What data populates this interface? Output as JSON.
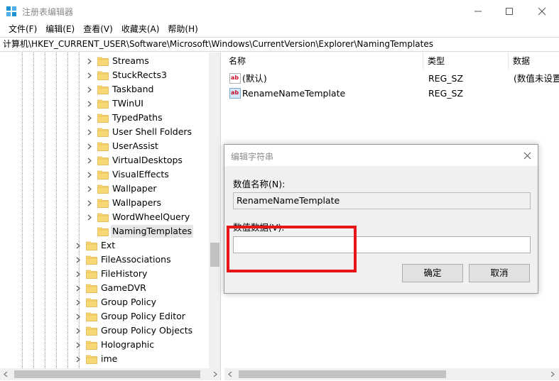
{
  "window": {
    "title": "注册表编辑器",
    "minimize_label": "minimize",
    "maximize_label": "maximize",
    "close_label": "close"
  },
  "menu": [
    {
      "label": "文件(F)"
    },
    {
      "label": "编辑(E)"
    },
    {
      "label": "查看(V)"
    },
    {
      "label": "收藏夹(A)"
    },
    {
      "label": "帮助(H)"
    }
  ],
  "address": "计算机\\HKEY_CURRENT_USER\\Software\\Microsoft\\Windows\\CurrentVersion\\Explorer\\NamingTemplates",
  "tree": {
    "items": [
      {
        "label": "Streams",
        "level": 1
      },
      {
        "label": "StuckRects3",
        "level": 1
      },
      {
        "label": "Taskband",
        "level": 1
      },
      {
        "label": "TWinUI",
        "level": 1
      },
      {
        "label": "TypedPaths",
        "level": 1
      },
      {
        "label": "User Shell Folders",
        "level": 1
      },
      {
        "label": "UserAssist",
        "level": 1
      },
      {
        "label": "VirtualDesktops",
        "level": 1
      },
      {
        "label": "VisualEffects",
        "level": 1
      },
      {
        "label": "Wallpaper",
        "level": 1
      },
      {
        "label": "Wallpapers",
        "level": 1
      },
      {
        "label": "WordWheelQuery",
        "level": 1
      },
      {
        "label": "NamingTemplates",
        "level": 1,
        "selected": true
      },
      {
        "label": "Ext",
        "level": 0
      },
      {
        "label": "FileAssociations",
        "level": 0
      },
      {
        "label": "FileHistory",
        "level": 0
      },
      {
        "label": "GameDVR",
        "level": 0
      },
      {
        "label": "Group Policy",
        "level": 0
      },
      {
        "label": "Group Policy Editor",
        "level": 0
      },
      {
        "label": "Group Policy Objects",
        "level": 0
      },
      {
        "label": "Holographic",
        "level": 0
      },
      {
        "label": "ime",
        "level": 0
      }
    ]
  },
  "list": {
    "columns": [
      "名称",
      "类型",
      "数据"
    ],
    "rows": [
      {
        "name": "(默认)",
        "type": "REG_SZ",
        "data": "(数值未设置)"
      },
      {
        "name": "RenameNameTemplate",
        "type": "REG_SZ",
        "data": ""
      }
    ]
  },
  "dialog": {
    "title": "编辑字符串",
    "name_label": "数值名称(N):",
    "name_value": "RenameNameTemplate",
    "data_label": "数值数据(V):",
    "data_value": "",
    "ok_label": "确定",
    "cancel_label": "取消"
  },
  "colors": {
    "highlight": "#e8141a",
    "folder": "#f8d775",
    "folder_dark": "#e3b64a",
    "accent": "#0078d7"
  }
}
